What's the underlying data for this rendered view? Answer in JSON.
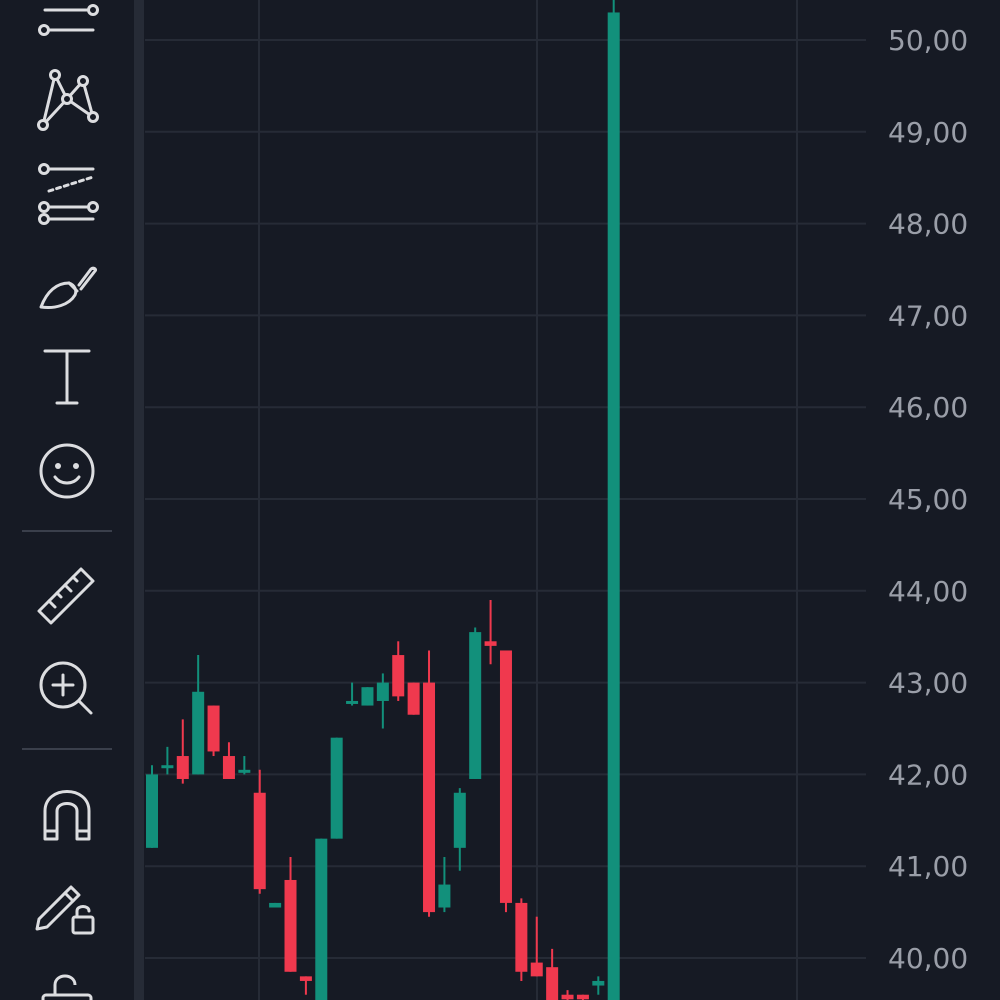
{
  "toolbar": {
    "tools": [
      {
        "icon": "horizontal-lines-icon"
      },
      {
        "icon": "pattern-nodes-icon"
      },
      {
        "icon": "forecast-lines-icon"
      },
      {
        "icon": "brush-icon"
      },
      {
        "icon": "text-icon"
      },
      {
        "icon": "emoji-icon"
      },
      {
        "icon": "ruler-icon"
      },
      {
        "icon": "zoom-in-icon"
      },
      {
        "icon": "magnet-icon"
      },
      {
        "icon": "lock-drawings-icon"
      },
      {
        "icon": "unlock-icon"
      }
    ]
  },
  "colors": {
    "background": "#161a24",
    "grid": "#262b36",
    "up": "#12907b",
    "down": "#f0394e",
    "icon": "#dcdde0",
    "tick_text": "#9a9ea8"
  },
  "chart_data": {
    "type": "candlestick",
    "y_axis": {
      "ticks": [
        "40,00",
        "41,00",
        "42,00",
        "43,00",
        "44,00",
        "45,00",
        "46,00",
        "47,00",
        "48,00",
        "49,00",
        "50,00"
      ],
      "tick_values": [
        40,
        41,
        42,
        43,
        44,
        45,
        46,
        47,
        48,
        49,
        50
      ],
      "position": "right"
    },
    "candles": [
      {
        "open": 41.2,
        "high": 42.1,
        "low": 41.2,
        "close": 42.0
      },
      {
        "open": 42.1,
        "high": 42.3,
        "low": 42.0,
        "close": 42.1
      },
      {
        "open": 42.2,
        "high": 42.6,
        "low": 41.9,
        "close": 41.95
      },
      {
        "open": 42.0,
        "high": 43.3,
        "low": 42.0,
        "close": 42.9
      },
      {
        "open": 42.75,
        "high": 42.75,
        "low": 42.2,
        "close": 42.25
      },
      {
        "open": 42.2,
        "high": 42.35,
        "low": 41.95,
        "close": 41.95
      },
      {
        "open": 42.05,
        "high": 42.2,
        "low": 42.0,
        "close": 42.05
      },
      {
        "open": 41.8,
        "high": 42.05,
        "low": 40.7,
        "close": 40.75
      },
      {
        "open": 40.55,
        "high": 40.6,
        "low": 40.55,
        "close": 40.6
      },
      {
        "open": 40.85,
        "high": 41.1,
        "low": 39.85,
        "close": 39.85
      },
      {
        "open": 39.8,
        "high": 39.8,
        "low": 39.6,
        "close": 39.75
      },
      {
        "open": 39.5,
        "high": 41.3,
        "low": 39.5,
        "close": 41.3
      },
      {
        "open": 41.3,
        "high": 42.4,
        "low": 41.3,
        "close": 42.4
      },
      {
        "open": 42.8,
        "high": 43.0,
        "low": 42.75,
        "close": 42.8
      },
      {
        "open": 42.75,
        "high": 42.95,
        "low": 42.75,
        "close": 42.95
      },
      {
        "open": 42.8,
        "high": 43.1,
        "low": 42.5,
        "close": 43.0
      },
      {
        "open": 43.3,
        "high": 43.45,
        "low": 42.8,
        "close": 42.85
      },
      {
        "open": 43.0,
        "high": 43.0,
        "low": 42.65,
        "close": 42.65
      },
      {
        "open": 43.0,
        "high": 43.35,
        "low": 40.45,
        "close": 40.5
      },
      {
        "open": 40.55,
        "high": 41.1,
        "low": 40.5,
        "close": 40.8
      },
      {
        "open": 41.2,
        "high": 41.85,
        "low": 40.95,
        "close": 41.8
      },
      {
        "open": 41.95,
        "high": 43.6,
        "low": 41.95,
        "close": 43.55
      },
      {
        "open": 43.45,
        "high": 43.9,
        "low": 43.2,
        "close": 43.4
      },
      {
        "open": 43.35,
        "high": 43.35,
        "low": 40.5,
        "close": 40.6
      },
      {
        "open": 40.6,
        "high": 40.65,
        "low": 39.75,
        "close": 39.85
      },
      {
        "open": 39.95,
        "high": 40.45,
        "low": 39.8,
        "close": 39.8
      },
      {
        "open": 39.9,
        "high": 40.1,
        "low": 39.4,
        "close": 39.4
      },
      {
        "open": 39.6,
        "high": 39.65,
        "low": 39.5,
        "close": 39.55
      },
      {
        "open": 39.6,
        "high": 39.6,
        "low": 39.5,
        "close": 39.55
      },
      {
        "open": 39.7,
        "high": 39.8,
        "low": 39.6,
        "close": 39.75
      },
      {
        "open": 39.5,
        "high": 50.45,
        "low": 39.5,
        "close": 50.3
      }
    ]
  }
}
